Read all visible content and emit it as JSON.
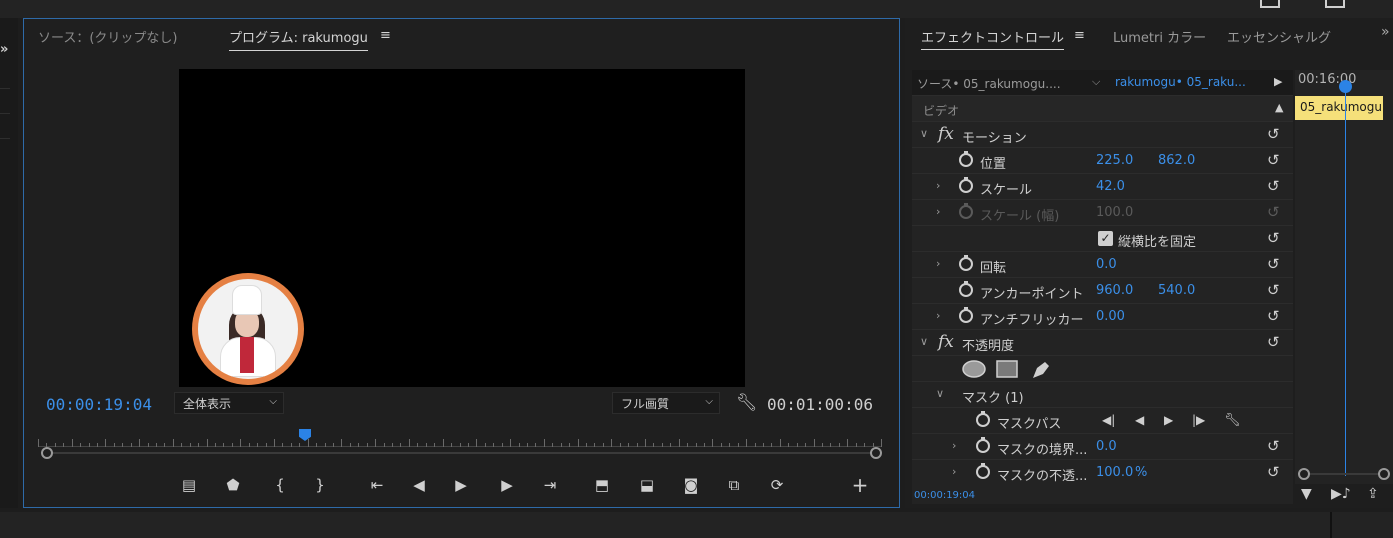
{
  "program": {
    "source_tab": "ソース：(クリップなし)",
    "program_tab": "プログラム: rakumogu",
    "menu_icon": "hamburger-icon",
    "current_timecode": "00:00:19:04",
    "duration_timecode": "00:01:00:06",
    "fit_select": "全体表示",
    "quality_select": "フル画質",
    "transport_icons": [
      "add-marker-frame-icon",
      "marker-icon",
      "mark-in-icon",
      "mark-out-icon",
      "go-to-in-icon",
      "step-back-icon",
      "play-icon",
      "step-forward-icon",
      "go-to-out-icon",
      "lift-icon",
      "extract-icon",
      "export-frame-icon",
      "comparison-view-icon",
      "toggle-proxies-icon",
      "add-button-icon"
    ]
  },
  "effect_controls": {
    "tabs": [
      "エフェクトコントロール",
      "Lumetri カラー",
      "エッセンシャルグ"
    ],
    "source_label": "ソース• 05_rakumogu....",
    "clip_label": "rakumogu• 05_raku...",
    "video_header": "ビデオ",
    "motion": {
      "title": "モーション",
      "position": {
        "label": "位置",
        "x": "225.0",
        "y": "862.0"
      },
      "scale": {
        "label": "スケール",
        "value": "42.0"
      },
      "scale_width": {
        "label": "スケール (幅)",
        "value": "100.0"
      },
      "uniform_scale": {
        "label": "縦横比を固定",
        "checked": true
      },
      "rotation": {
        "label": "回転",
        "value": "0.0"
      },
      "anchor": {
        "label": "アンカーポイント",
        "x": "960.0",
        "y": "540.0"
      },
      "antiflicker": {
        "label": "アンチフリッカー",
        "value": "0.00"
      }
    },
    "opacity": {
      "title": "不透明度",
      "mask": {
        "label": "マスク (1)"
      },
      "mask_path": {
        "label": "マスクパス"
      },
      "mask_feather": {
        "label": "マスクの境界...",
        "value": "0.0"
      },
      "mask_opacity": {
        "label": "マスクの不透...",
        "value": "100.0",
        "unit": "%"
      }
    },
    "timecode": "00:00:19:04"
  },
  "timeline": {
    "time": "00:16:00",
    "clip_name": "05_rakumogu"
  }
}
